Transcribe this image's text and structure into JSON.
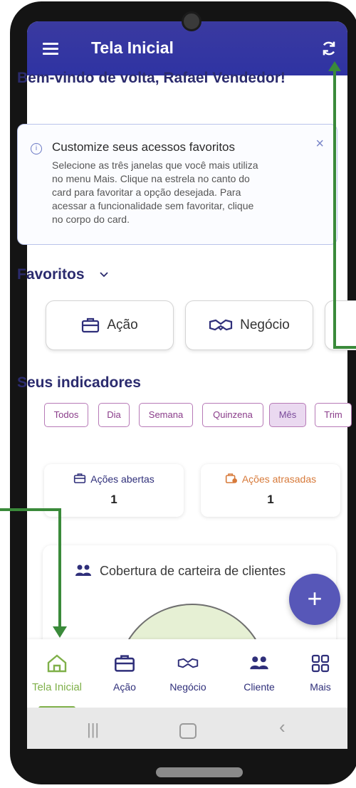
{
  "appbar": {
    "title": "Tela Inicial"
  },
  "welcome": "Bem-vindo de volta, Rafael Vendedor!",
  "info_card": {
    "title": "Customize seus acessos favoritos",
    "text": "Selecione as três janelas que você mais utiliza no menu Mais. Clique na estrela no canto do card para favoritar a opção desejada. Para acessar a funcionalidade sem favoritar, clique no corpo do card.",
    "close": "×"
  },
  "favorites": {
    "header": "Favoritos",
    "items": [
      {
        "label": "Ação"
      },
      {
        "label": "Negócio"
      }
    ]
  },
  "indicators": {
    "title": "Seus indicadores",
    "filters": [
      "Todos",
      "Dia",
      "Semana",
      "Quinzena",
      "Mês",
      "Trim"
    ],
    "active_filter": "Mês",
    "stats": [
      {
        "label": "Ações abertas",
        "value": "1",
        "color": "#2f2f7a"
      },
      {
        "label": "Ações atrasadas",
        "value": "1",
        "color": "#d77a3a"
      }
    ]
  },
  "coverage": {
    "title": "Cobertura de carteira de clientes"
  },
  "fab": {
    "label": "+"
  },
  "bottom_nav": {
    "items": [
      {
        "label": "Tela Inicial",
        "icon": "home-icon",
        "active": true
      },
      {
        "label": "Ação",
        "icon": "briefcase-icon"
      },
      {
        "label": "Negócio",
        "icon": "handshake-icon"
      },
      {
        "label": "Cliente",
        "icon": "clients-icon"
      },
      {
        "label": "Mais",
        "icon": "grid-icon"
      }
    ]
  },
  "colors": {
    "primary": "#2f33a3",
    "accent_green": "#7fb049",
    "pill_border": "#b77ab7"
  }
}
